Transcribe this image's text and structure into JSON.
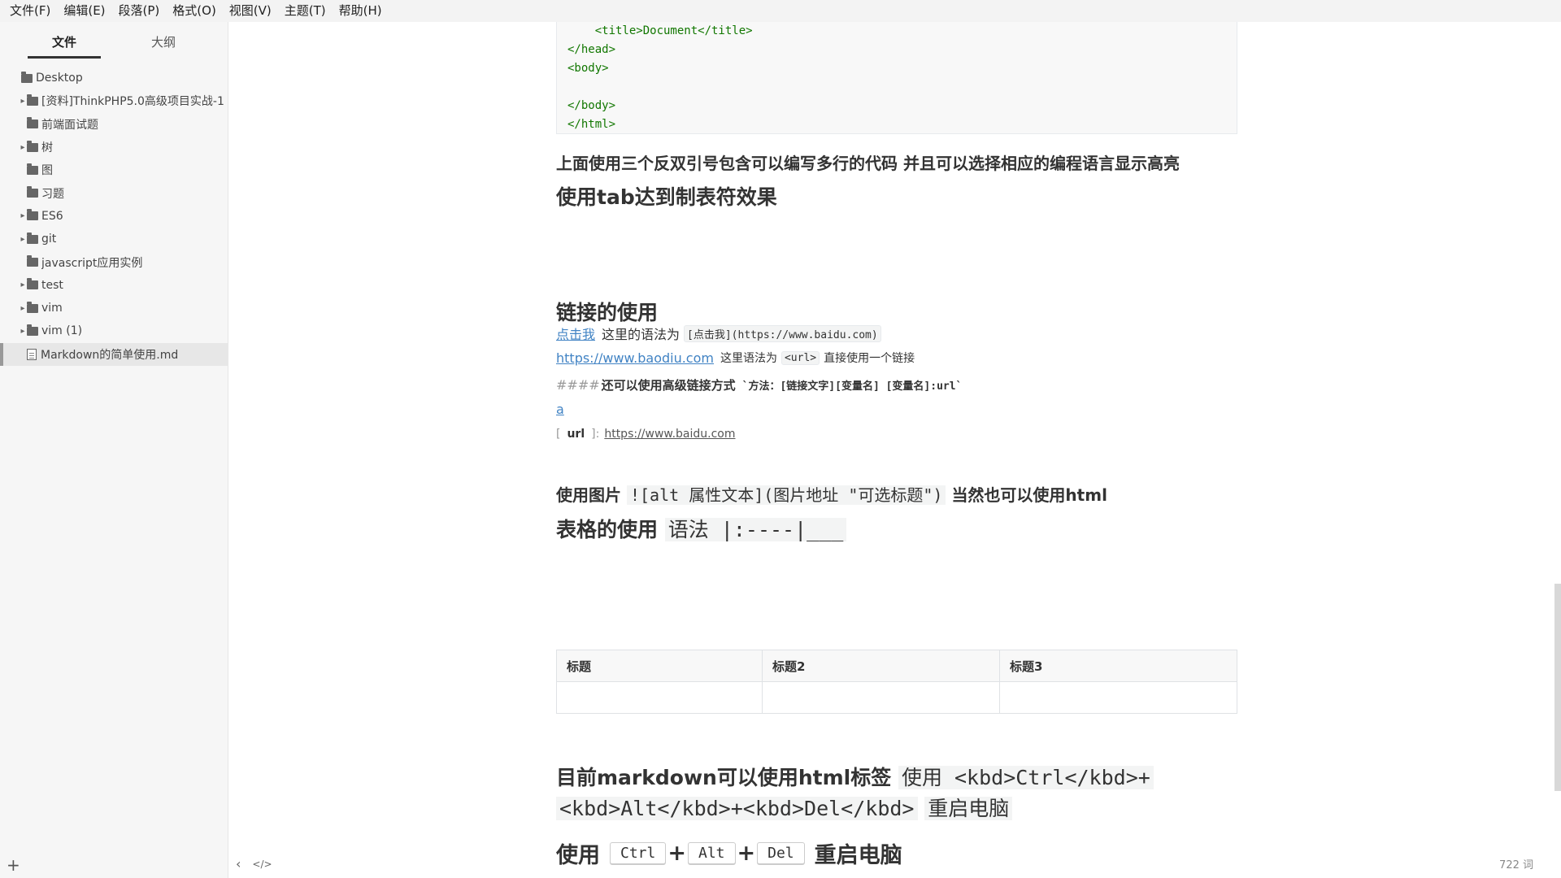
{
  "menubar": {
    "items": [
      "文件(F)",
      "编辑(E)",
      "段落(P)",
      "格式(O)",
      "视图(V)",
      "主题(T)",
      "帮助(H)"
    ]
  },
  "sidebar": {
    "tabs": [
      "文件",
      "大纲"
    ],
    "tree": [
      {
        "label": "Desktop",
        "level": 0,
        "arrow": false,
        "type": "folder"
      },
      {
        "label": "[资料]ThinkPHP5.0高级项目实战-1",
        "level": 1,
        "arrow": true,
        "type": "folder"
      },
      {
        "label": "前端面试题",
        "level": 1,
        "arrow": false,
        "type": "folder"
      },
      {
        "label": "树",
        "level": 1,
        "arrow": true,
        "type": "folder"
      },
      {
        "label": "图",
        "level": 1,
        "arrow": false,
        "type": "folder"
      },
      {
        "label": "习题",
        "level": 1,
        "arrow": false,
        "type": "folder"
      },
      {
        "label": "ES6",
        "level": 1,
        "arrow": true,
        "type": "folder"
      },
      {
        "label": "git",
        "level": 1,
        "arrow": true,
        "type": "folder"
      },
      {
        "label": "javascript应用实例",
        "level": 1,
        "arrow": false,
        "type": "folder"
      },
      {
        "label": "test",
        "level": 1,
        "arrow": true,
        "type": "folder"
      },
      {
        "label": "vim",
        "level": 1,
        "arrow": true,
        "type": "folder"
      },
      {
        "label": "vim (1)",
        "level": 1,
        "arrow": true,
        "type": "folder"
      },
      {
        "label": "Markdown的简单使用.md",
        "level": 1,
        "arrow": false,
        "type": "file",
        "active": true
      }
    ],
    "add_label": "+"
  },
  "code": {
    "lines": [
      "    <title>Document</title>",
      "</head>",
      "<body>",
      "",
      "</body>",
      "</html>"
    ]
  },
  "doc": {
    "p1": "上面使用三个反双引号包含可以编写多行的代码 并且可以选择相应的编程语言显示高亮",
    "p2": "使用tab达到制表符效果",
    "h_links": "链接的使用",
    "link1_text": "点击我",
    "link1_desc": "这里的语法为",
    "link1_code": "[点击我](https://www.baidu.com)",
    "link2_text": "https://www.baodiu.com",
    "link2_desc": "这里语法为",
    "link2_code": "<url>",
    "link2_desc2": "直接使用一个链接",
    "adv_hash": "####",
    "adv_text": "还可以使用高级链接方式",
    "adv_code": "`方法：[链接文字][变量名]   [变量名]:url`",
    "link_a": "a",
    "ref_open": "[",
    "ref_name": "url",
    "ref_close": "]:",
    "ref_url": "https://www.baidu.com",
    "img_prefix": "使用图片",
    "img_code": "![alt 属性文本](图片地址 \"可选标题\")",
    "img_suffix": "当然也可以使用html",
    "table_prefix": "表格的使用",
    "table_syntax": "语法 |:----|___",
    "table_headers": [
      "标题",
      "标题2",
      "标题3"
    ],
    "html_prefix": "目前markdown可以使用html标签",
    "html_code1": "使用 <kbd>Ctrl</kbd>+",
    "html_code2": "<kbd>Alt</kbd>+<kbd>Del</kbd>",
    "html_suffix": "重启电脑",
    "kbd_prefix": "使用",
    "kbd_keys": [
      "Ctrl",
      "Alt",
      "Del"
    ],
    "kbd_plus": "+",
    "kbd_suffix": "重启电脑"
  },
  "status": {
    "back": "‹",
    "source": "</>",
    "word_count": "722 词"
  }
}
